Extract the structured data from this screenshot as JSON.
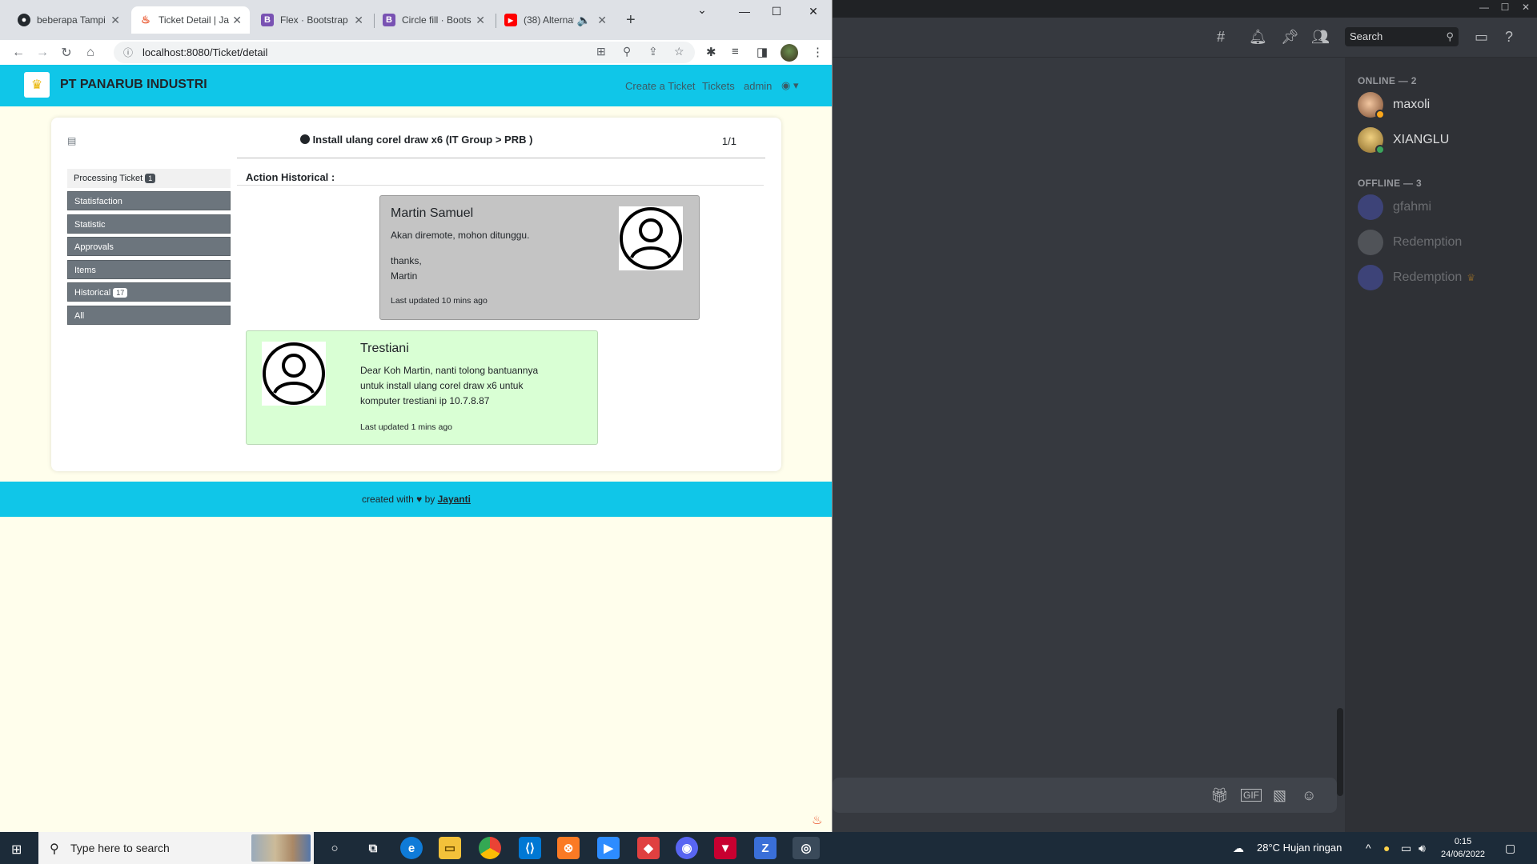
{
  "browser": {
    "tabs": [
      {
        "label": "beberapa Tampi",
        "icon": "github-icon"
      },
      {
        "label": "Ticket Detail | Ja",
        "icon": "flame-icon"
      },
      {
        "label": "Flex · Bootstrap",
        "icon": "bootstrap-icon"
      },
      {
        "label": "Circle fill · Boots",
        "icon": "bootstrap-icon"
      },
      {
        "label": "(38) Alternat",
        "icon": "youtube-icon"
      }
    ],
    "url": "localhost:8080/Ticket/detail"
  },
  "site": {
    "brand": "PT PANARUB INDUSTRI",
    "nav": {
      "create": "Create a Ticket",
      "tickets": "Tickets",
      "user": "admin"
    },
    "ticket": {
      "title": "Install ulang corel draw x6 (IT Group > PRB )",
      "pager": "1/1"
    },
    "sidebar": {
      "head": {
        "label": "Processing Ticket",
        "count": "1"
      },
      "items": [
        {
          "label": "Statisfaction"
        },
        {
          "label": "Statistic"
        },
        {
          "label": "Approvals"
        },
        {
          "label": "Items"
        },
        {
          "label": "Historical",
          "count": "17"
        },
        {
          "label": "All"
        }
      ]
    },
    "action_label": "Action Historical :",
    "messages": [
      {
        "name": "Martin Samuel",
        "line1": "Akan diremote, mohon ditunggu.",
        "line2": "thanks,",
        "line3": "Martin",
        "updated": "Last updated 10 mins ago"
      },
      {
        "name": "Trestiani",
        "line1": "Dear Koh Martin, nanti tolong bantuannya",
        "line2": "untuk install ulang corel draw x6 untuk",
        "line3": "komputer trestiani ip 10.7.8.87",
        "updated": "Last updated 1 mins ago"
      }
    ],
    "footer": {
      "prefix": "created with",
      "by": "by",
      "author": "Jayanti"
    }
  },
  "discord": {
    "search_placeholder": "Search",
    "online_header": "ONLINE — 2",
    "offline_header": "OFFLINE — 3",
    "online": [
      {
        "name": "maxoli"
      },
      {
        "name": "XIANGLU"
      }
    ],
    "offline": [
      {
        "name": "gfahmi"
      },
      {
        "name": "Redemption"
      },
      {
        "name": "Redemption"
      }
    ],
    "colors": {
      "bg": "#36393f",
      "sidebar": "#2f3136",
      "online": "#3ba55c",
      "idle": "#faa61a"
    }
  },
  "taskbar": {
    "search_placeholder": "Type here to search",
    "weather": "28°C  Hujan ringan",
    "time": "0:15",
    "date": "24/06/2022"
  }
}
